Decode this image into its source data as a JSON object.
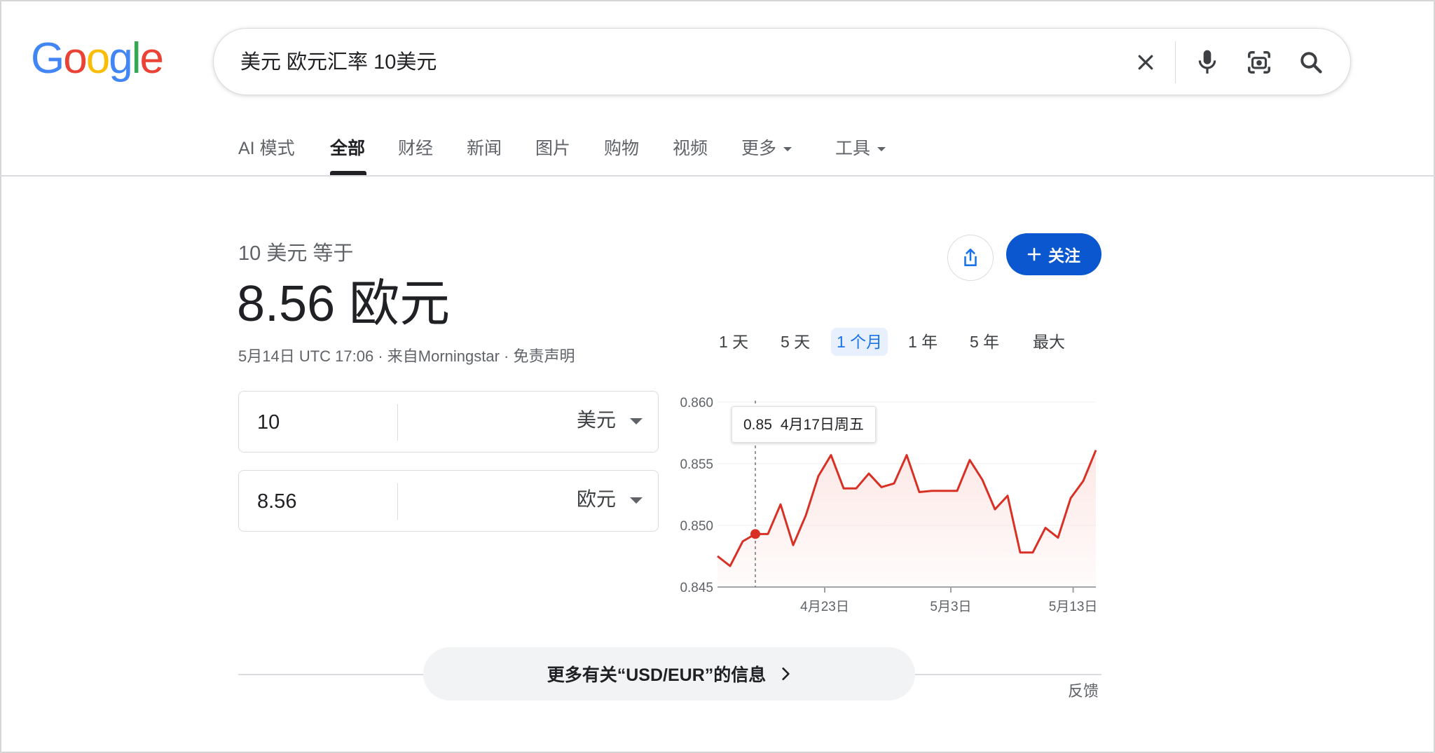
{
  "logo": {
    "letters": [
      "G",
      "o",
      "o",
      "g",
      "l",
      "e"
    ],
    "colors": [
      "#4285F4",
      "#EA4335",
      "#FBBC05",
      "#4285F4",
      "#34A853",
      "#EA4335"
    ]
  },
  "search": {
    "query": "美元 欧元汇率 10美元",
    "icons": [
      "close-icon",
      "mic-icon",
      "lens-icon",
      "search-icon"
    ]
  },
  "tabs": [
    {
      "label": "AI 模式"
    },
    {
      "label": "全部",
      "active": true
    },
    {
      "label": "财经"
    },
    {
      "label": "新闻"
    },
    {
      "label": "图片"
    },
    {
      "label": "购物"
    },
    {
      "label": "视频"
    },
    {
      "label": "更多"
    },
    {
      "label": "工具"
    }
  ],
  "converter": {
    "equals_label": "10 美元 等于",
    "result": "8.56 欧元",
    "meta_time": "5月14日 UTC 17:06",
    "meta_sep1": " · ",
    "meta_source": "来自Morningstar",
    "meta_sep2": " · ",
    "meta_disclaimer": "免责声明",
    "from_value": "10",
    "from_unit": "美元",
    "to_value": "8.56",
    "to_unit": "欧元",
    "follow_label": "关注",
    "accent": "#0b57d0"
  },
  "ranges": [
    {
      "label": "1 天"
    },
    {
      "label": "5 天"
    },
    {
      "label": "1 个月",
      "active": true
    },
    {
      "label": "1 年"
    },
    {
      "label": "5 年"
    },
    {
      "label": "最大"
    }
  ],
  "tooltip": {
    "value": "0.85",
    "date": "4月17日周五"
  },
  "chart_data": {
    "type": "area",
    "y_ticks": [
      "0.860",
      "0.855",
      "0.850",
      "0.845"
    ],
    "ylim": [
      0.845,
      0.86
    ],
    "x_ticks": [
      {
        "label": "4月23日",
        "index": 8.5
      },
      {
        "label": "5月3日",
        "index": 18.5
      },
      {
        "label": "5月13日",
        "index": 28.2
      }
    ],
    "highlight_index": 3,
    "values": [
      0.8475,
      0.8467,
      0.8487,
      0.8493,
      0.8493,
      0.8517,
      0.8484,
      0.8508,
      0.854,
      0.8557,
      0.853,
      0.853,
      0.8542,
      0.8531,
      0.8534,
      0.8557,
      0.8527,
      0.8528,
      0.8528,
      0.8528,
      0.8553,
      0.8537,
      0.8513,
      0.8524,
      0.8478,
      0.8478,
      0.8498,
      0.849,
      0.8522,
      0.8536,
      0.8561
    ],
    "line_color": "#d93025",
    "fill_color": "#fce8e6"
  },
  "more_info": {
    "label": "更多有关“USD/EUR”的信息"
  },
  "feedback": "反馈"
}
